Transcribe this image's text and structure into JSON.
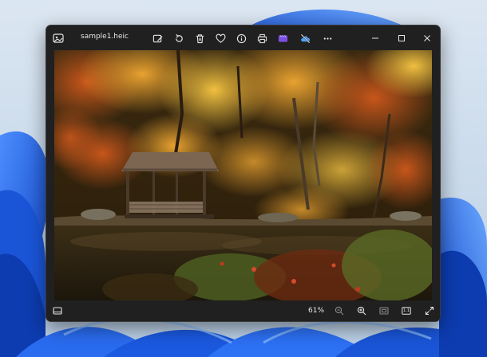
{
  "window": {
    "file_name": "sample1.heic"
  },
  "toolbar": {
    "edit_icon": "edit-image-icon",
    "rotate_icon": "rotate-icon",
    "delete_icon": "trash-icon",
    "favorite_icon": "heart-icon",
    "info_icon": "info-icon",
    "print_icon": "printer-icon",
    "clipchamp_icon": "clipchamp-icon",
    "onedrive_icon": "cloud-off-icon",
    "more_icon": "more-icon"
  },
  "bottom_bar": {
    "zoom_level": "61%",
    "actual_size_label": "1:1"
  },
  "colors": {
    "window_bg": "#202020",
    "clipchamp_accent": "#7b4fe0",
    "onedrive_accent": "#4aa3ff",
    "wallpaper_blue": "#1f5fe0"
  }
}
